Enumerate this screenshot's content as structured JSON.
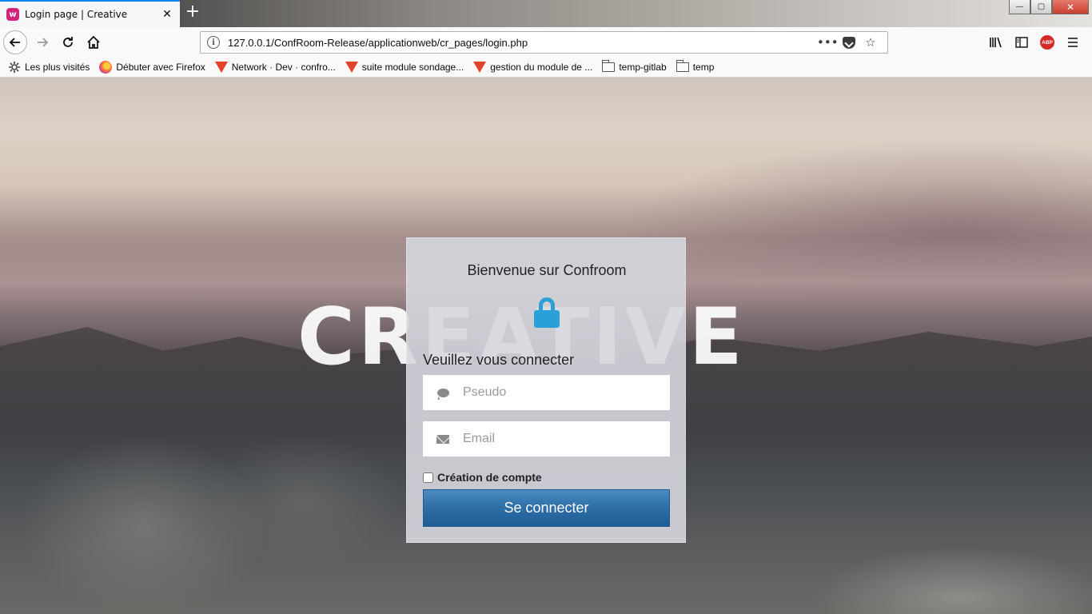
{
  "browser": {
    "tab_title": "Login page | Creative",
    "tab_favicon_letter": "w",
    "new_tab_symbol": "+",
    "url": "127.0.0.1/ConfRoom-Release/applicationweb/cr_pages/login.php",
    "page_actions": "•••",
    "window_controls": {
      "minimize": "—",
      "maximize": "▢",
      "close": "✕"
    },
    "addon_label": "ABP",
    "bookmarks": [
      {
        "label": "Les plus visités",
        "icon": "gear-icon"
      },
      {
        "label": "Débuter avec Firefox",
        "icon": "firefox-icon"
      },
      {
        "label": "Network · Dev · confro...",
        "icon": "gitlab-icon"
      },
      {
        "label": "suite module sondage...",
        "icon": "gitlab-icon"
      },
      {
        "label": "gestion du module de ...",
        "icon": "gitlab-icon"
      },
      {
        "label": "temp-gitlab",
        "icon": "folder-icon"
      },
      {
        "label": "temp",
        "icon": "folder-icon"
      }
    ]
  },
  "page": {
    "brand_text": "CREATIVE",
    "login": {
      "title": "Bienvenue sur Confroom",
      "subtitle": "Veuillez vous connecter",
      "pseudo_placeholder": "Pseudo",
      "email_placeholder": "Email",
      "checkbox_label": "Création de compte",
      "checkbox_checked": false,
      "submit_label": "Se connecter"
    }
  },
  "colors": {
    "tab_accent": "#0a84ff",
    "lock_icon": "#2a9fd8",
    "button_blue": "#2e6da6",
    "abp_red": "#d42a2a"
  }
}
